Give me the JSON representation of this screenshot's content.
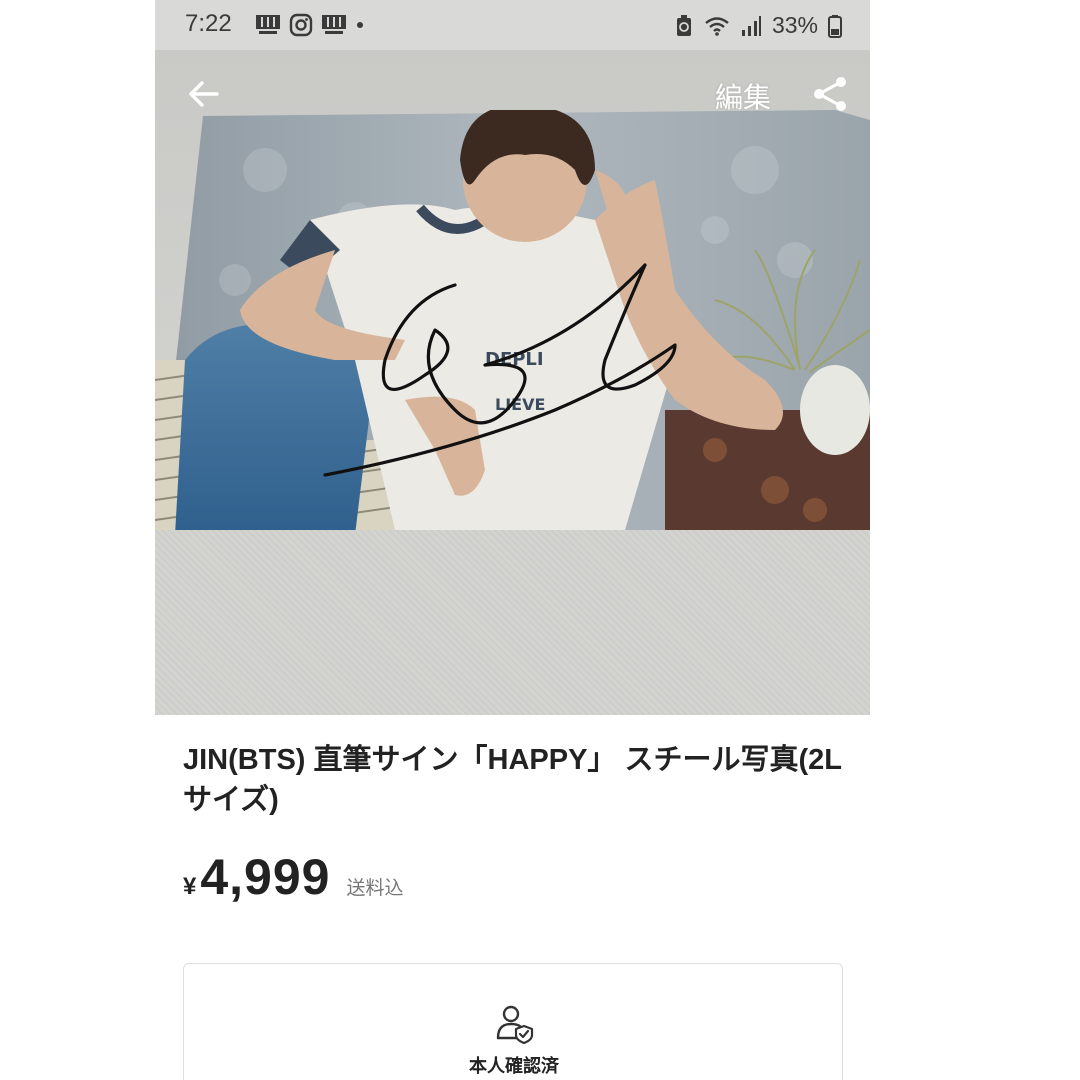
{
  "status_bar": {
    "time": "7:22",
    "battery": "33%",
    "left_icons": [
      "rakuma-icon",
      "instagram-icon",
      "rakuma-icon",
      "dot-icon"
    ],
    "right_icons": [
      "battery-saver-icon",
      "wifi-icon",
      "signal-icon",
      "battery-icon"
    ]
  },
  "header": {
    "edit_label": "編集",
    "back_icon": "arrow-left-icon",
    "share_icon": "share-icon"
  },
  "item": {
    "title": "JIN(BTS) 直筆サイン「HAPPY」 スチール写真(2Lサイズ)",
    "currency": "¥",
    "price": "4,999",
    "shipping": "送料込"
  },
  "verification": {
    "icon": "user-shield-icon",
    "label": "本人確認済"
  }
}
